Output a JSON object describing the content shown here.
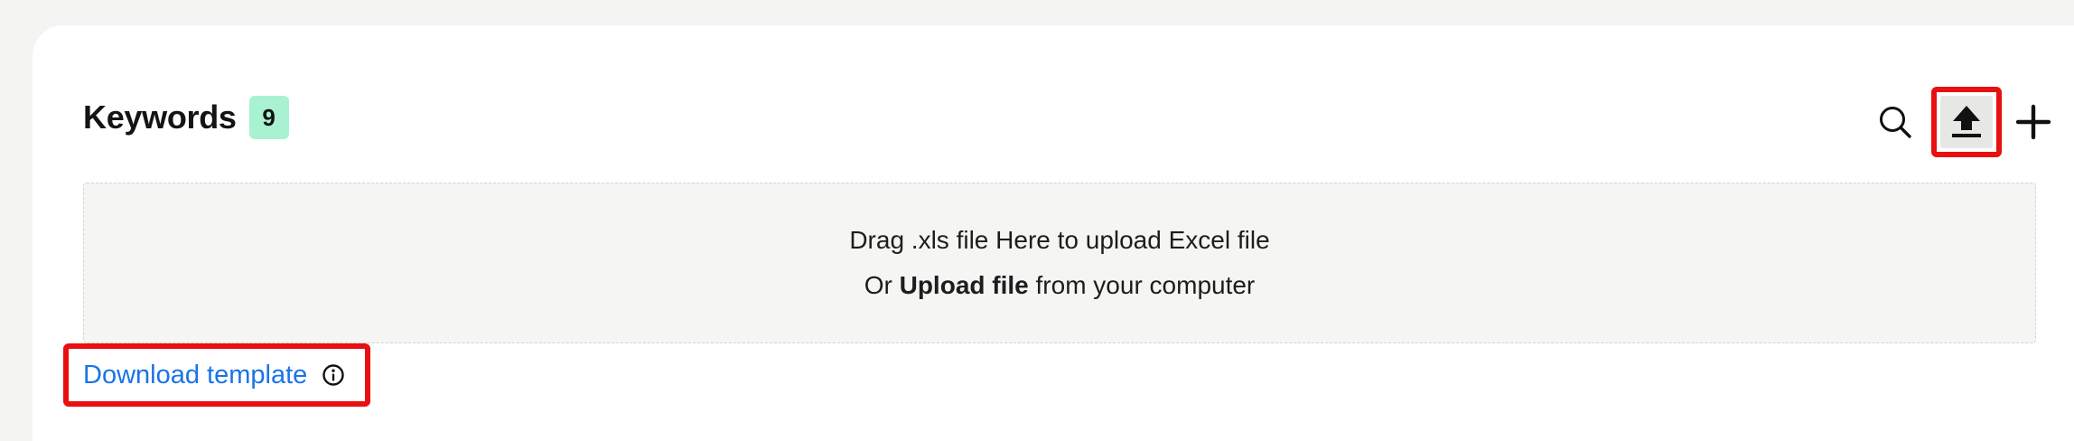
{
  "section": {
    "title": "Keywords",
    "count": "9"
  },
  "toolbar": {
    "icons": [
      "search-icon",
      "upload-icon",
      "plus-icon"
    ]
  },
  "dropzone": {
    "line1": "Drag .xls file Here to upload Excel file",
    "line2_prefix": "Or ",
    "line2_link": "Upload file",
    "line2_suffix": " from your computer"
  },
  "template": {
    "link_label": "Download template",
    "icon": "info-icon"
  },
  "colors": {
    "badge": "#a8f2d1",
    "highlight": "#e81010",
    "link": "#1a73e8"
  }
}
